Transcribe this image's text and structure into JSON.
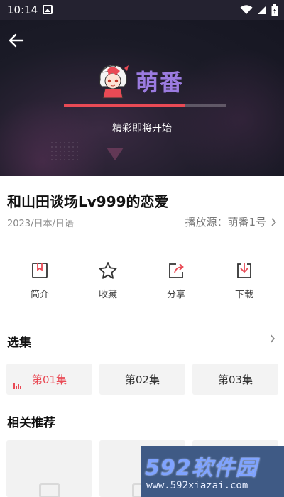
{
  "status_bar": {
    "time": "10:14"
  },
  "player": {
    "logo_text": "萌番",
    "loading_text": "精彩即将开始",
    "progress": 0.75
  },
  "video": {
    "title": "和山田谈场Lv999的恋爱",
    "meta": "2023/日本/日语",
    "source_label": "播放源：萌番1号"
  },
  "actions": [
    {
      "label": "简介",
      "icon": "bookmark-icon"
    },
    {
      "label": "收藏",
      "icon": "star-icon"
    },
    {
      "label": "分享",
      "icon": "share-icon"
    },
    {
      "label": "下载",
      "icon": "download-icon"
    }
  ],
  "episodes": {
    "title": "选集",
    "items": [
      {
        "label": "第01集",
        "active": true
      },
      {
        "label": "第02集",
        "active": false
      },
      {
        "label": "第03集",
        "active": false
      }
    ]
  },
  "recommendations": {
    "title": "相关推荐"
  },
  "watermark": {
    "brand": "592软件园",
    "url": "www.592xiazai.com"
  },
  "colors": {
    "accent": "#e94a55",
    "logo": "#9b7be0",
    "player_bg": "#1b1b27"
  }
}
